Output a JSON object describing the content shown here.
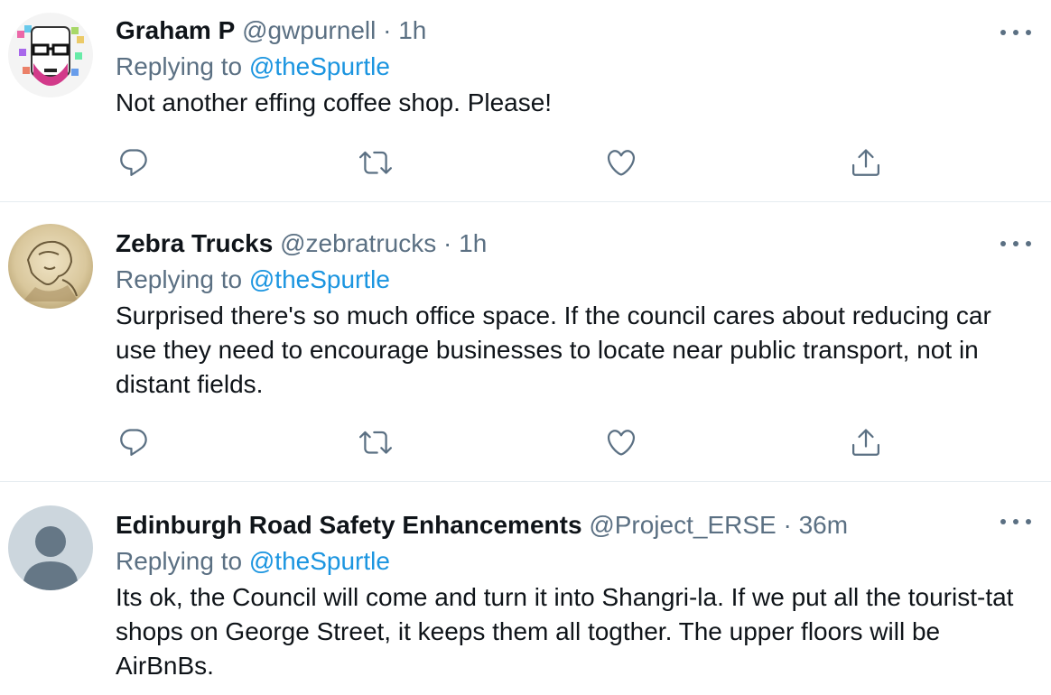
{
  "tweets": [
    {
      "name": "Graham P",
      "handle": "@gwpurnell",
      "separator": "·",
      "time": "1h",
      "replying_prefix": "Replying to",
      "replying_to": "@theSpurtle",
      "text": "Not another effing coffee shop. Please!",
      "avatar_icon": "pixel-art-face-avatar"
    },
    {
      "name": "Zebra Trucks",
      "handle": "@zebratrucks",
      "separator": "·",
      "time": "1h",
      "replying_prefix": "Replying to",
      "replying_to": "@theSpurtle",
      "text": "Surprised there's so much office space. If the council cares about reducing car use they need to encourage businesses to locate near public transport, not in distant fields.",
      "avatar_icon": "sepia-sketch-avatar"
    },
    {
      "name": "Edinburgh Road Safety Enhancements",
      "handle": "@Project_ERSE",
      "separator": "·",
      "time": "36m",
      "replying_prefix": "Replying to",
      "replying_to": "@theSpurtle",
      "text": "Its ok, the Council will come and turn it into Shangri-la. If we put all the tourist-tat shops on George Street, it keeps them all togther. The upper floors will be AirBnBs.",
      "avatar_icon": "default-person-avatar"
    }
  ],
  "icons": {
    "reply": "reply-icon",
    "retweet": "retweet-icon",
    "like": "heart-icon",
    "share": "share-icon",
    "more": "more-dots-icon"
  },
  "colors": {
    "name": "#0f1419",
    "secondary": "#5b7083",
    "mention": "#1b95e0",
    "divider": "#e6ecf0"
  }
}
